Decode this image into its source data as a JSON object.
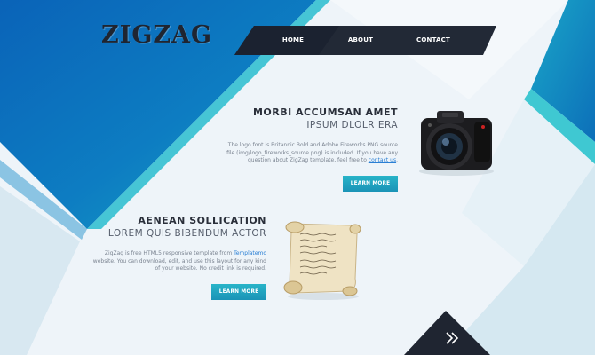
{
  "header": {
    "logo_text": "ZIGZAG"
  },
  "nav": {
    "items": [
      {
        "label": "HOME"
      },
      {
        "label": "ABOUT"
      },
      {
        "label": "CONTACT"
      }
    ]
  },
  "section1": {
    "title": "MORBI ACCUMSAN AMET",
    "subtitle": "IPSUM DLOLR ERA",
    "text_prefix": "The logo font is Britannic Bold and Adobe Fireworks PNG source file (img/logo_fireworks_source.png) is included. If you have any question about ZigZag template, feel free to ",
    "link_text": "contact us",
    "text_suffix": ".",
    "button_label": "LEARN MORE"
  },
  "section2": {
    "title": "AENEAN SOLLICATION",
    "subtitle": "LOREM QUIS BIBENDUM ACTOR",
    "text_prefix": "ZigZag is free HTML5 responsive template from ",
    "link_text": "Templatemo",
    "text_suffix": " website. You can download, edit, and use this layout for any kind of your website. No credit link is required.",
    "button_label": "LEARN MORE"
  },
  "icons": {
    "camera": "camera-image",
    "scroll": "paper-scroll-image",
    "next": "double-chevron-right-icon"
  },
  "colors": {
    "accent": "#1a93b7",
    "teal": "#3fc8d2",
    "deep_blue": "#0b5aa8",
    "dark": "#1f2531",
    "bg": "#eef4f9"
  }
}
